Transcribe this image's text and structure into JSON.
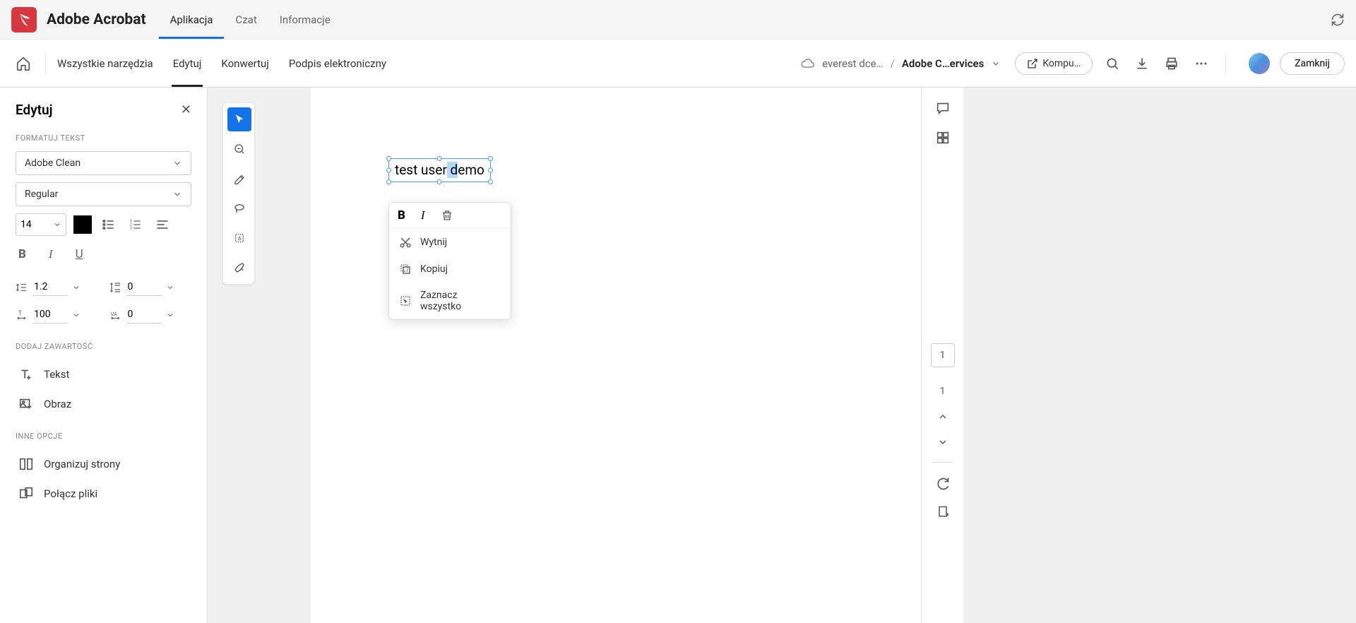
{
  "app": {
    "title": "Adobe Acrobat"
  },
  "topTabs": {
    "t0": "Aplikacja",
    "t1": "Czat",
    "t2": "Informacje"
  },
  "toolTabs": {
    "t0": "Wszystkie narzędzia",
    "t1": "Edytuj",
    "t2": "Konwertuj",
    "t3": "Podpis elektroniczny"
  },
  "breadcrumb": {
    "file": "everest dce…",
    "sep": "/",
    "loc": "Adobe C…ervices"
  },
  "buttons": {
    "computer": "Kompu…",
    "close": "Zamknij"
  },
  "sidebar": {
    "title": "Edytuj",
    "sectionFormat": "FORMATUJ TEKST",
    "font": "Adobe Clean",
    "weight": "Regular",
    "size": "14",
    "lineHeight": "1.2",
    "spaceAfter": "0",
    "horizScale": "100",
    "charSpacing": "0",
    "sectionAdd": "DODAJ ZAWARTOŚĆ",
    "addText": "Tekst",
    "addImage": "Obraz",
    "sectionOther": "INNE OPCJE",
    "organize": "Organizuj strony",
    "combine": "Połącz pliki"
  },
  "doc": {
    "textPre": "test user",
    "textSel": " d",
    "textPost": "emo"
  },
  "contextMenu": {
    "cut": "Wytnij",
    "copy": "Kopiuj",
    "selectAll": "Zaznacz wszystko"
  },
  "pages": {
    "current": "1",
    "total": "1"
  }
}
